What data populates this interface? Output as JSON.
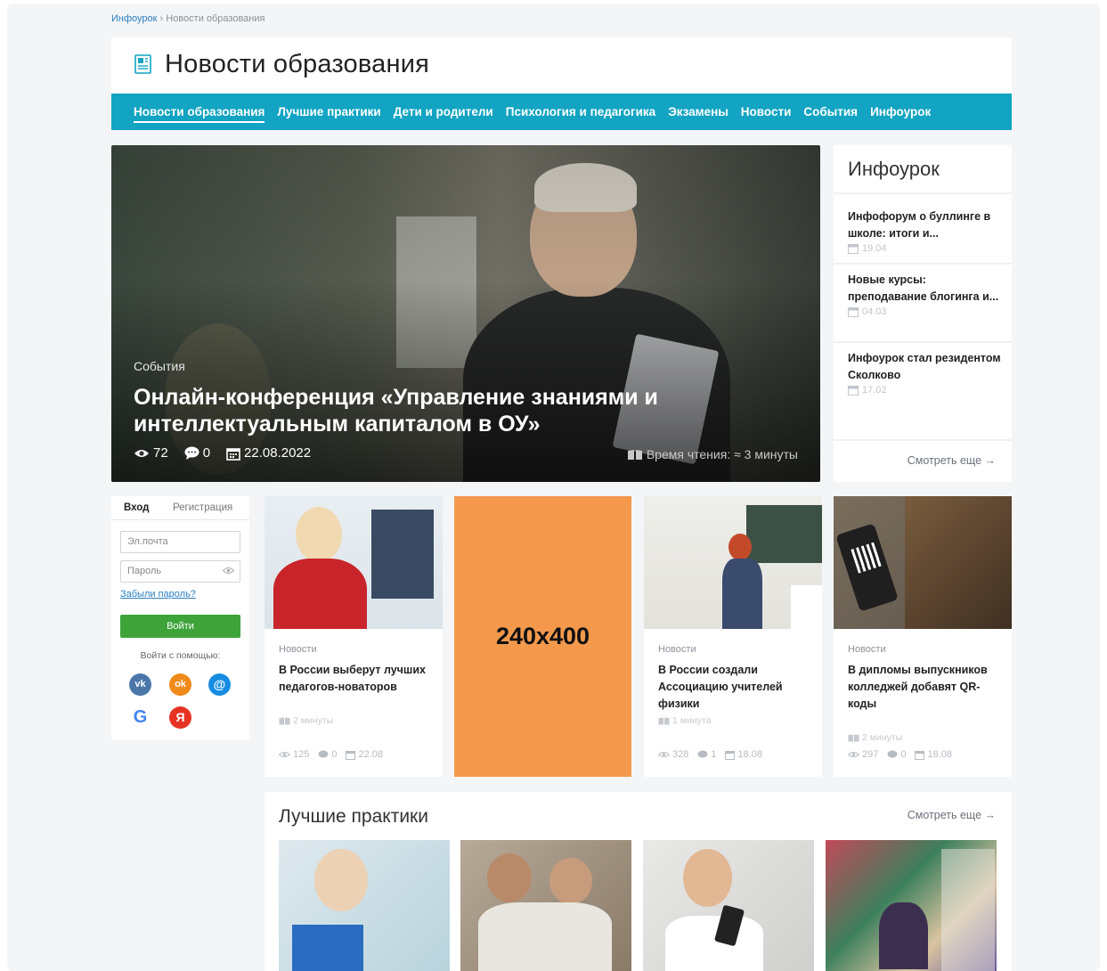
{
  "breadcrumb": {
    "home": "Инфоурок",
    "separator": "›",
    "current": "Новости образования"
  },
  "page": {
    "title": "Новости образования"
  },
  "nav": {
    "items": [
      "Новости образования",
      "Лучшие практики",
      "Дети и родители",
      "Психология и педагогика",
      "Экзамены",
      "Новости",
      "События",
      "Инфоурок"
    ],
    "active_index": 0
  },
  "hero": {
    "category": "События",
    "title": "Онлайн-конференция «Управление знаниями и интеллектуальным капиталом в ОУ»",
    "views": "72",
    "comments": "0",
    "date": "22.08.2022",
    "read_time": "Время чтения: ≈ 3 минуты"
  },
  "sidebar": {
    "title": "Инфоурок",
    "items": [
      {
        "title": "Инфофорум о буллинге в школе: итоги и...",
        "date": "19.04"
      },
      {
        "title": "Новые курсы: преподавание блогинга и...",
        "date": "04.03"
      },
      {
        "title": "Инфоурок стал резидентом Сколково",
        "date": "17.02"
      }
    ],
    "more": "Смотреть еще →"
  },
  "login": {
    "tab_login": "Вход",
    "tab_register": "Регистрация",
    "email_placeholder": "Эл.почта",
    "password_placeholder": "Пароль",
    "forgot": "Забыли пароль?",
    "submit": "Войти",
    "via": "Войти с помощью:",
    "social": {
      "vk": "vk",
      "ok": "ok",
      "mail": "@",
      "google": "G",
      "yandex": "Я"
    }
  },
  "cards": [
    {
      "category": "Новости",
      "title": "В России выберут лучших педагогов-новаторов",
      "read_time": "2 минуты",
      "views": "125",
      "comments": "0",
      "date": "22.08"
    },
    {
      "category": "Новости",
      "title": "В России создали Ассоциацию учителей физики",
      "read_time": "1 минута",
      "views": "328",
      "comments": "1",
      "date": "18.08"
    },
    {
      "category": "Новости",
      "title": "В дипломы выпускников колледжей добавят QR-коды",
      "read_time": "2 минуты",
      "views": "297",
      "comments": "0",
      "date": "18.08"
    }
  ],
  "ad": {
    "label": "240x400"
  },
  "practices": {
    "title": "Лучшие практики",
    "more": "Смотреть еще →"
  },
  "colors": {
    "accent": "#12a4c2",
    "login_button": "#3ea43a",
    "ad": "#f4994c",
    "link": "#2a7fc1"
  },
  "icons": {
    "views": "eye-icon",
    "comments": "comment-icon",
    "date": "calendar-icon",
    "read_time": "book-icon"
  }
}
